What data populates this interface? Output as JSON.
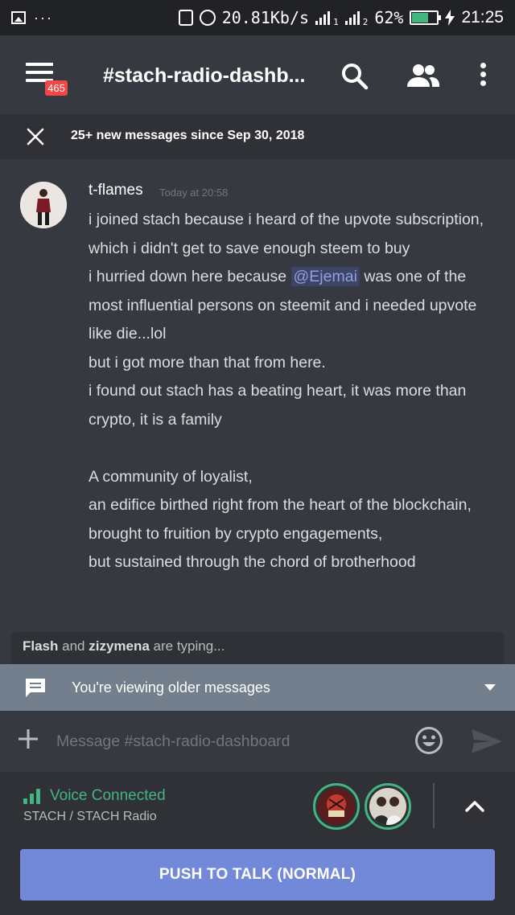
{
  "status_bar": {
    "network_speed": "20.81Kb/s",
    "sim1": "1",
    "sim2": "2",
    "battery": "62%",
    "battery_level": 0.62,
    "time": "21:25",
    "colors": {
      "background": "#202225",
      "battery_fill": "#43b581"
    }
  },
  "header": {
    "channel_name": "#stach-radio-dashb...",
    "unread_badge": "465",
    "icons": [
      "menu-icon",
      "search-icon",
      "members-icon",
      "more-vertical-icon"
    ]
  },
  "new_messages_bar": {
    "text": "25+ new messages since Sep 30, 2018"
  },
  "message": {
    "author": "t-flames",
    "timestamp": "Today at 20:58",
    "line1": "i joined stach because i heard of the upvote subscription, which i didn't get to save enough steem to buy",
    "line2_before": "i hurried down here because ",
    "mention": "@Ejemai",
    "line2_after": " was one of the most influential persons on steemit and i needed upvote like die...lol",
    "line3": "but i got more than that from here.",
    "line4": "i found out stach has a beating heart, it was more than crypto, it is a family",
    "line5": "A community of loyalist,",
    "line6": "an edifice birthed right from the heart of the blockchain,",
    "line7": "brought to fruition by crypto engagements,",
    "line8": "but sustained through the chord of brotherhood"
  },
  "typing": {
    "user1": "Flash",
    "and": " and ",
    "user2": "zizymena",
    "suffix": " are typing..."
  },
  "older_messages_bar": {
    "text": "You're viewing older messages"
  },
  "composer": {
    "placeholder": "Message #stach-radio-dashboard"
  },
  "voice": {
    "status": "Voice Connected",
    "server": "STACH / STACH Radio",
    "push_to_talk": "PUSH TO TALK (NORMAL)"
  },
  "colors": {
    "background": "#36393f",
    "panel": "#2f3136",
    "blurple": "#7289da",
    "green": "#43b581",
    "badge_red": "#f04747",
    "older_bar": "#747f8d"
  }
}
